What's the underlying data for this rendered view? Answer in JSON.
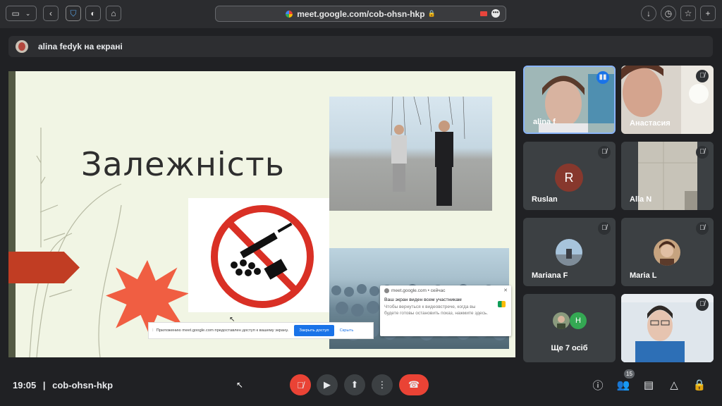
{
  "browser": {
    "url": "meet.google.com/cob-ohsn-hkp",
    "lock_glyph": "🔒"
  },
  "presenter": {
    "label": "alina fedyk на екрані"
  },
  "slide": {
    "title": "Залежність"
  },
  "share_bar": {
    "text": "Приложению meet.google.com предоставлен доступ к вашему экрану.",
    "stop_label": "Закрыть доступ",
    "hide_label": "Скрыть"
  },
  "toast": {
    "source": "meet.google.com • сейчас",
    "title": "Ваш экран виден всем участникам",
    "body": "Чтобы вернуться к видеовстрече, когда вы будете готовы остановить показ, нажмите здесь."
  },
  "participants": [
    {
      "name": "alina f",
      "type": "video",
      "speaking": true
    },
    {
      "name": "Анастасия",
      "type": "video",
      "muted": true
    },
    {
      "name": "Ruslan",
      "type": "letter",
      "letter": "R",
      "muted": true
    },
    {
      "name": "Alla N",
      "type": "video",
      "muted": true
    },
    {
      "name": "Mariana F",
      "type": "photo",
      "muted": true
    },
    {
      "name": "Maria L",
      "type": "photo",
      "muted": true
    },
    {
      "name": "Ще 7 осіб",
      "type": "more",
      "letter": "H"
    },
    {
      "name": "",
      "type": "video",
      "muted": true
    }
  ],
  "footer": {
    "time": "19:05",
    "separator": "|",
    "meeting_code": "cob-ohsn-hkp",
    "participant_count": "15"
  },
  "colors": {
    "accent_red": "#ea4335",
    "speaking_blue": "#1a73e8",
    "tile_bg": "#3c4043"
  }
}
